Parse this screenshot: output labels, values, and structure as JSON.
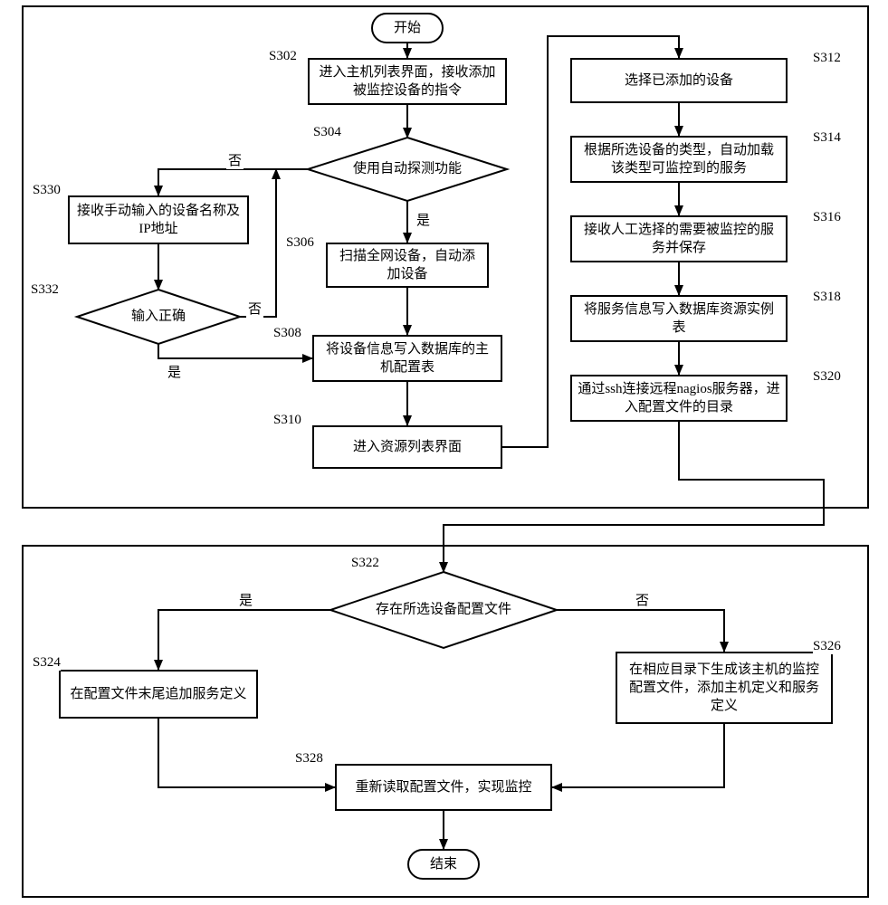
{
  "terminals": {
    "start": "开始",
    "end": "结束"
  },
  "steps": {
    "s302": {
      "label": "S302",
      "text": "进入主机列表界面，接收添加被监控设备的指令"
    },
    "s304": {
      "label": "S304",
      "text": "使用自动探测功能"
    },
    "s306": {
      "label": "S306",
      "text": "扫描全网设备，自动添加设备"
    },
    "s308": {
      "label": "S308",
      "text": "将设备信息写入数据库的主机配置表"
    },
    "s310": {
      "label": "S310",
      "text": "进入资源列表界面"
    },
    "s312": {
      "label": "S312",
      "text": "选择已添加的设备"
    },
    "s314": {
      "label": "S314",
      "text": "根据所选设备的类型，自动加载该类型可监控到的服务"
    },
    "s316": {
      "label": "S316",
      "text": "接收人工选择的需要被监控的服务并保存"
    },
    "s318": {
      "label": "S318",
      "text": "将服务信息写入数据库资源实例表"
    },
    "s320": {
      "label": "S320",
      "text": "通过ssh连接远程nagios服务器，进入配置文件的目录"
    },
    "s322": {
      "label": "S322",
      "text": "存在所选设备配置文件"
    },
    "s324": {
      "label": "S324",
      "text": "在配置文件末尾追加服务定义"
    },
    "s326": {
      "label": "S326",
      "text": "在相应目录下生成该主机的监控配置文件，添加主机定义和服务定义"
    },
    "s328": {
      "label": "S328",
      "text": "重新读取配置文件，实现监控"
    },
    "s330": {
      "label": "S330",
      "text": "接收手动输入的设备名称及IP地址"
    },
    "s332": {
      "label": "S332",
      "text": "输入正确"
    }
  },
  "edge_labels": {
    "yes": "是",
    "no": "否"
  }
}
